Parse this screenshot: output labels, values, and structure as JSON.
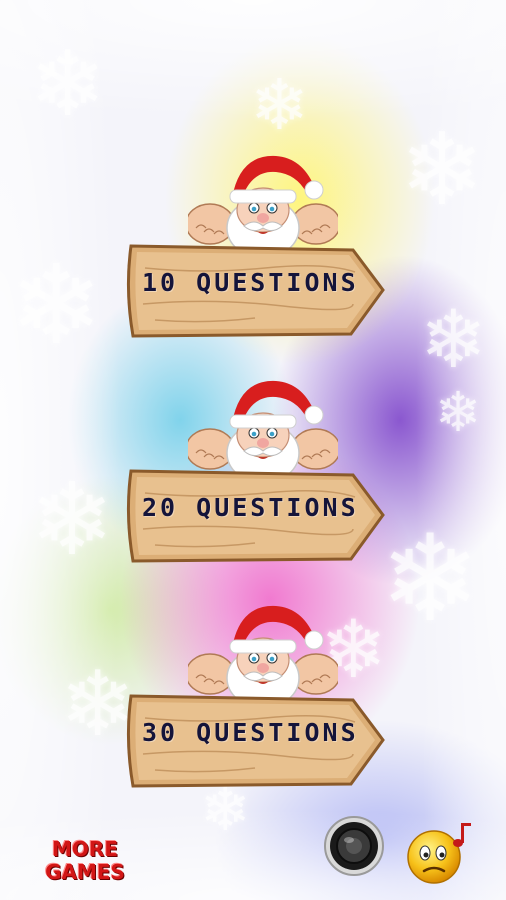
{
  "menu": {
    "options": [
      {
        "label": "10 QUESTIONS"
      },
      {
        "label": "20 QUESTIONS"
      },
      {
        "label": "30 QUESTIONS"
      }
    ]
  },
  "footer": {
    "more_games_line1": "MORE",
    "more_games_line2": "GAMES",
    "speaker_icon": "speaker-icon",
    "music_icon": "music-face-icon"
  },
  "colors": {
    "santa_red": "#d81e1e",
    "wood": "#e0b27a",
    "label_text": "#14143a",
    "more_games_red": "#d21616"
  }
}
